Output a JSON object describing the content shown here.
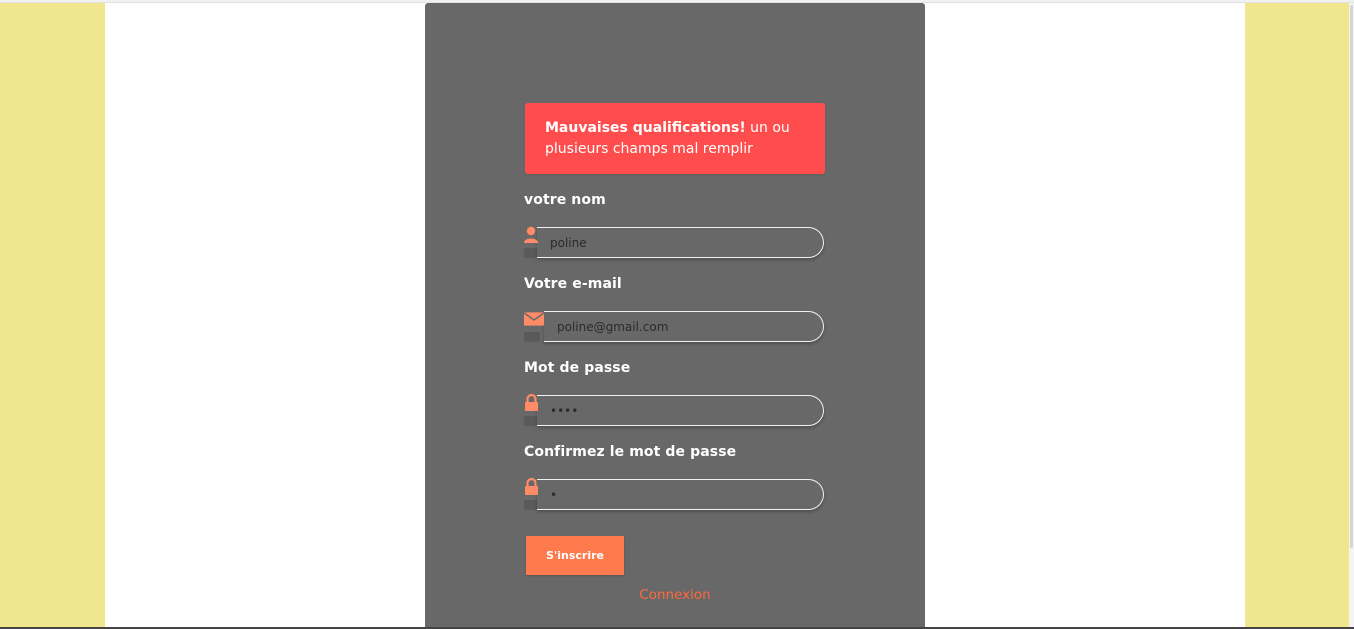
{
  "alert": {
    "bold_text": "Mauvaises qualifications!",
    "text": " un ou plusieurs champs mal remplir"
  },
  "form": {
    "name_label": "votre nom",
    "name_value": "poline",
    "email_label": "Votre e-mail",
    "email_value": "poline@gmail.com",
    "password_label": "Mot de passe",
    "password_value": "abcd",
    "confirm_label": "Confirmez le mot de passe",
    "confirm_value": "a",
    "submit_label": "S'inscrire",
    "login_link": "Connexion"
  },
  "icons": {
    "name": "user-icon",
    "email": "envelope-icon",
    "password": "lock-icon",
    "confirm": "lock-icon"
  },
  "colors": {
    "panel": "#686868",
    "alert": "#ff4d4d",
    "accent": "#ff7a4c",
    "link": "#ff6a3d",
    "side": "#efe68e"
  }
}
